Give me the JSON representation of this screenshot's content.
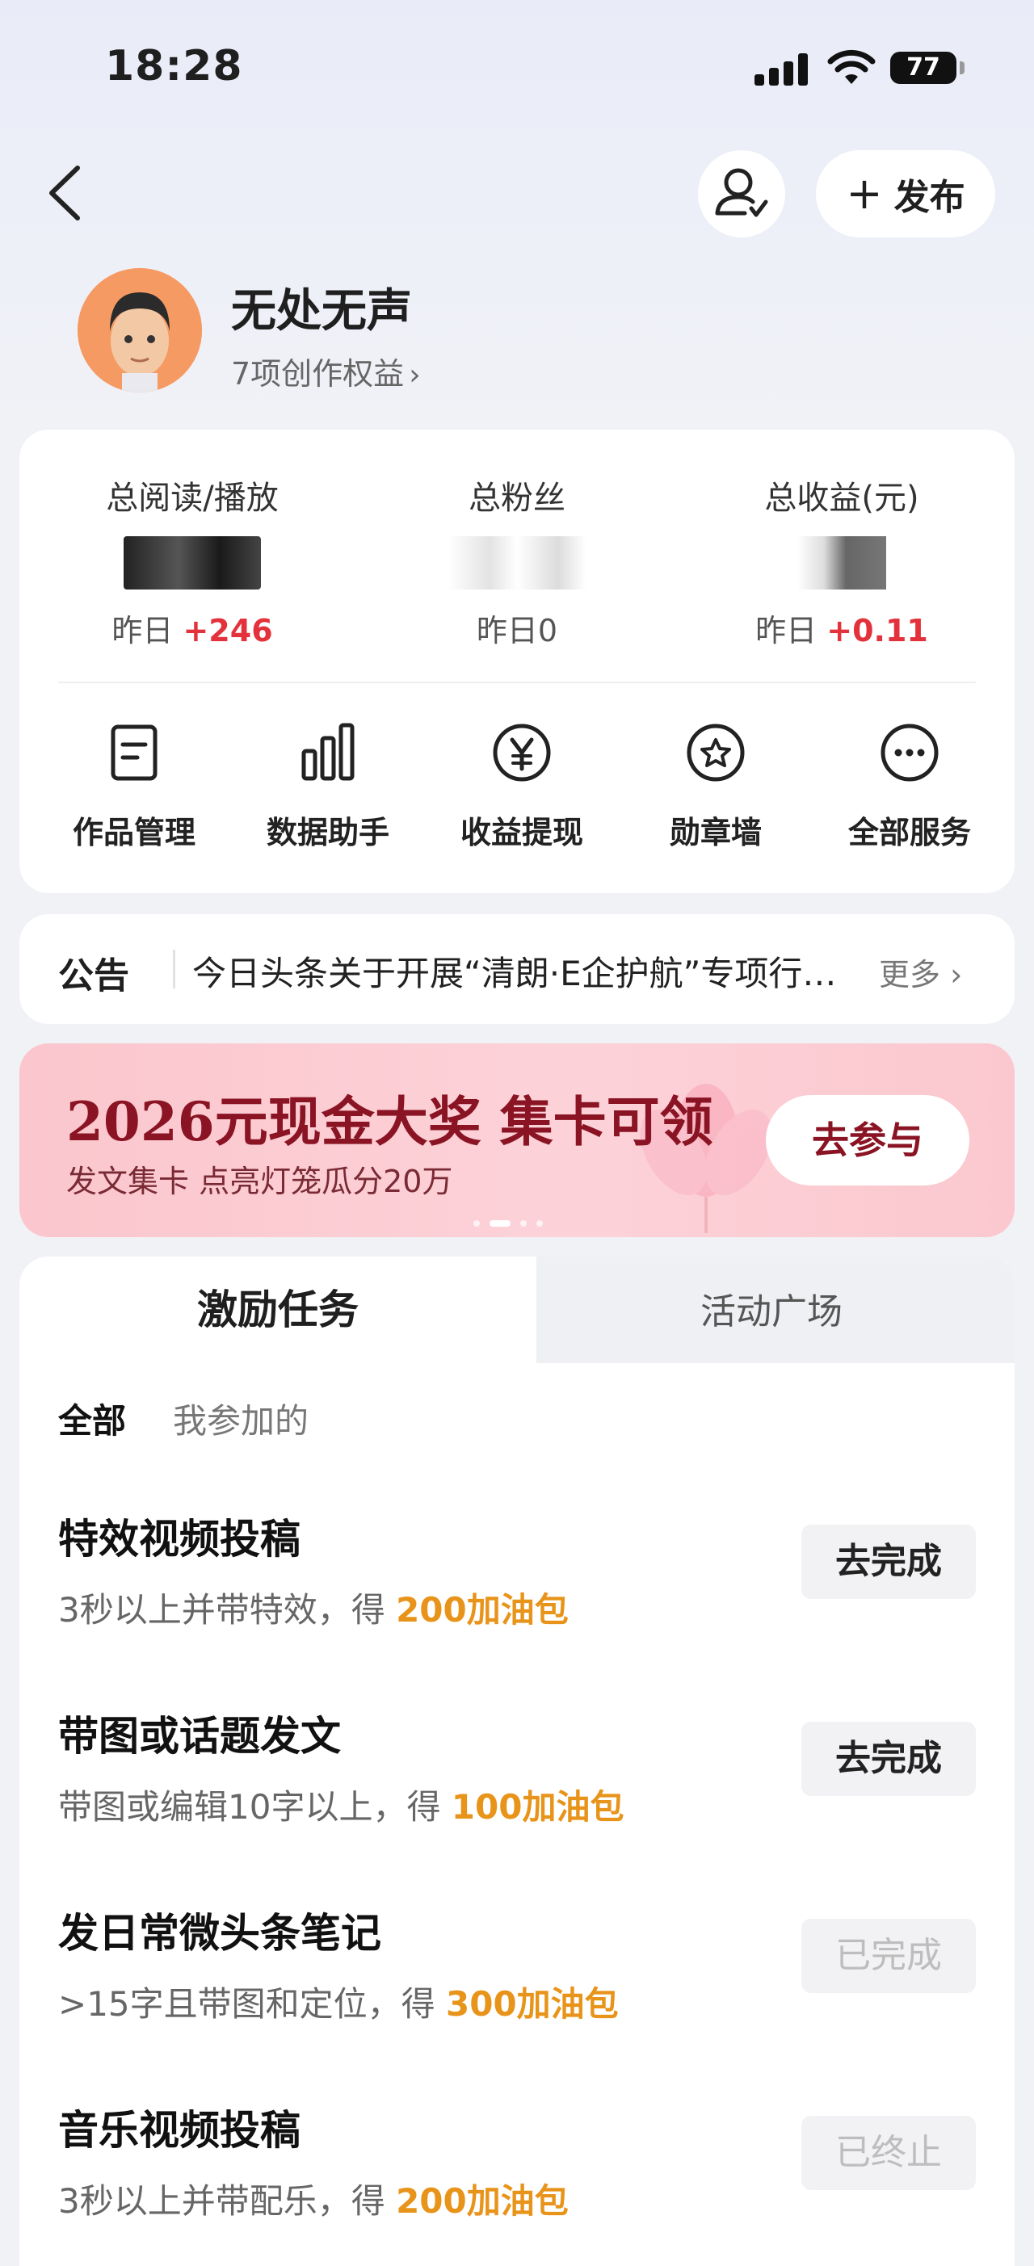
{
  "status_bar": {
    "time": "18:28",
    "battery": "77"
  },
  "header": {
    "publish_label": "发布"
  },
  "profile": {
    "name": "无处无声",
    "rights": "7项创作权益"
  },
  "stats": [
    {
      "label": "总阅读/播放",
      "yesterday_prefix": "昨日",
      "yesterday_value": "+246"
    },
    {
      "label": "总粉丝",
      "yesterday_prefix": "昨日",
      "yesterday_value": "0"
    },
    {
      "label": "总收益(元)",
      "yesterday_prefix": "昨日",
      "yesterday_value": "+0.11"
    }
  ],
  "services": [
    {
      "label": "作品管理",
      "icon": "document-icon"
    },
    {
      "label": "数据助手",
      "icon": "bar-chart-icon"
    },
    {
      "label": "收益提现",
      "icon": "yuan-icon"
    },
    {
      "label": "勋章墙",
      "icon": "medal-icon"
    },
    {
      "label": "全部服务",
      "icon": "more-icon"
    }
  ],
  "notice": {
    "title": "公告",
    "text": "今日头条关于开展“清朗·E企护航”专项行动的公告",
    "more": "更多"
  },
  "banner": {
    "title": "2026元现金大奖 集卡可领",
    "subtitle": "发文集卡 点亮灯笼瓜分20万",
    "button": "去参与",
    "colors": {
      "bg": "#fbc6cd",
      "text": "#8a1423"
    }
  },
  "tasks_section": {
    "tabs": [
      "激励任务",
      "活动广场"
    ],
    "subtabs": [
      "全部",
      "我参加的"
    ],
    "tasks": [
      {
        "title": "特效视频投稿",
        "desc": "3秒以上并带特效，得 ",
        "reward": "200加油包",
        "button": "去完成",
        "state": "todo"
      },
      {
        "title": "带图或话题发文",
        "desc": "带图或编辑10字以上，得 ",
        "reward": "100加油包",
        "button": "去完成",
        "state": "todo"
      },
      {
        "title": "发日常微头条笔记",
        "desc": ">15字且带图和定位，得 ",
        "reward": "300加油包",
        "button": "已完成",
        "state": "done"
      },
      {
        "title": "音乐视频投稿",
        "desc": "3秒以上并带配乐，得 ",
        "reward": "200加油包",
        "button": "已终止",
        "state": "done"
      }
    ]
  },
  "colors": {
    "accent_red": "#e3323c",
    "reward_orange": "#e8941a"
  }
}
